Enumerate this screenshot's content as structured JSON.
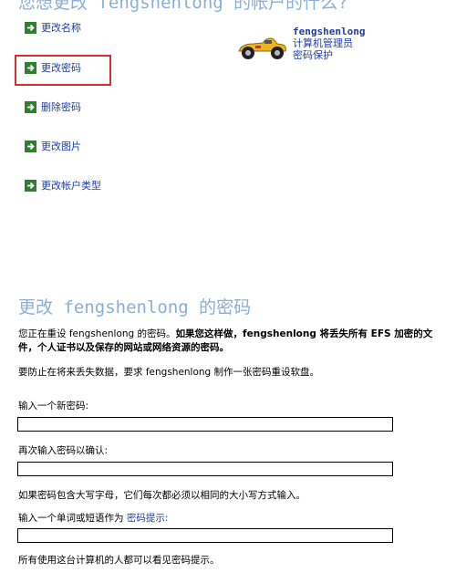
{
  "top_heading": "您想更改 fengshenlong 的帐户的什么?",
  "tasks": [
    {
      "label": "更改名称"
    },
    {
      "label": "更改密码"
    },
    {
      "label": "删除密码"
    },
    {
      "label": "更改图片"
    },
    {
      "label": "更改帐户类型"
    }
  ],
  "user": {
    "name": "fengshenlong",
    "role": "计算机管理员",
    "status": "密码保护",
    "picture_icon": "race-car-icon"
  },
  "section_heading": "更改 fengshenlong 的密码",
  "info": {
    "text_plain": "您正在重设 fengshenlong 的密码。",
    "text_bold": "如果您这样做，fengshenlong 将丢失所有 EFS 加密的文件，个人证书以及保存的网站或网络资源的密码。",
    "reset_disk_note": "要防止在将来丢失数据，要求 fengshenlong 制作一张密码重设软盘。"
  },
  "form": {
    "new_password_label": "输入一个新密码:",
    "new_password_value": "",
    "confirm_password_label": "再次输入密码以确认:",
    "confirm_password_value": "",
    "case_note": "如果密码包含大写字母，它们每次都必须以相同的大小写方式输入。",
    "hint_label_prefix": "输入一个单词或短语作为",
    "hint_link": "密码提示:",
    "hint_value": "",
    "hint_note": "所有使用这台计算机的人都可以看见密码提示。"
  },
  "colors": {
    "heading": "#8aaed8",
    "link": "#1f3f9f",
    "task_arrow": "#2f7f2f",
    "highlight": "#d32f2f"
  }
}
